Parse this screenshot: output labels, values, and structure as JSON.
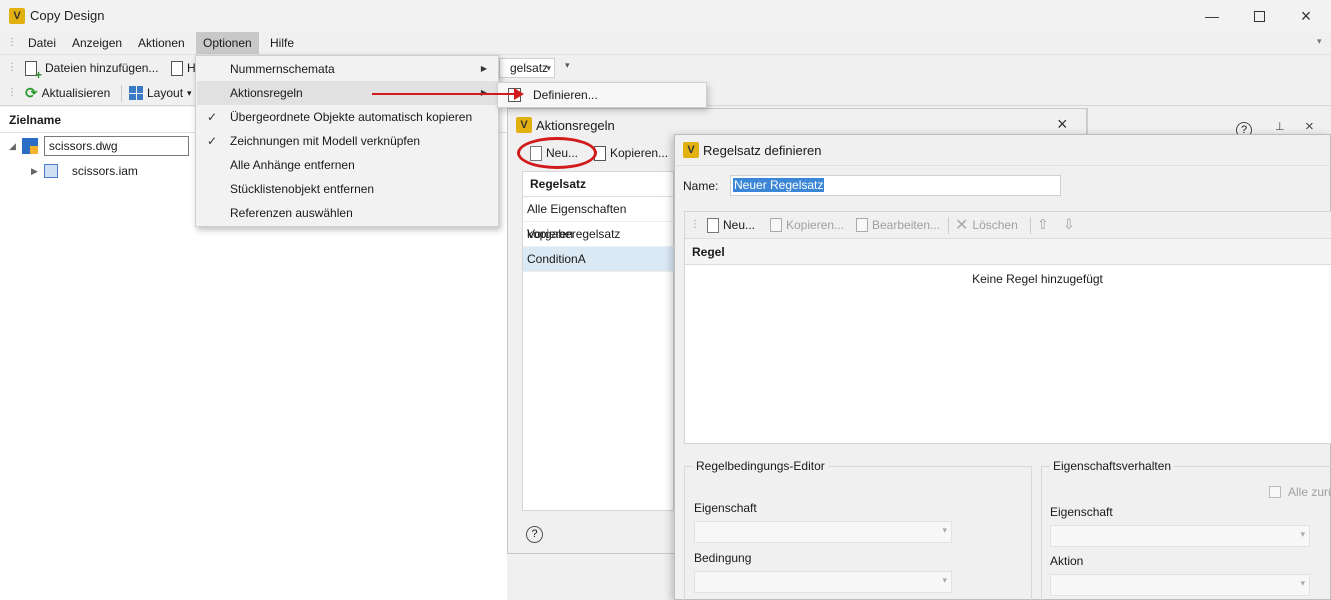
{
  "window": {
    "title": "Copy Design",
    "logo_letter": "V"
  },
  "menubar": {
    "items": [
      "Datei",
      "Anzeigen",
      "Aktionen",
      "Optionen",
      "Hilfe"
    ]
  },
  "toolbar1": {
    "add_files": "Dateien hinzufügen...",
    "partial_label": "H",
    "regelsatz_combo": "gelsatz"
  },
  "toolbar2": {
    "refresh": "Aktualisieren",
    "layout": "Layout"
  },
  "tree": {
    "header": "Zielname",
    "rows": [
      {
        "label": "scissors.dwg"
      },
      {
        "label": "scissors.iam"
      }
    ]
  },
  "context_menu": {
    "items": [
      {
        "label": "Nummernschemata",
        "checked": false,
        "submenu": true
      },
      {
        "label": "Aktionsregeln",
        "checked": false,
        "submenu": true
      },
      {
        "label": "Übergeordnete Objekte automatisch kopieren",
        "checked": true,
        "submenu": false
      },
      {
        "label": "Zeichnungen mit Modell verknüpfen",
        "checked": true,
        "submenu": false
      },
      {
        "label": "Alle Anhänge entfernen",
        "checked": false,
        "submenu": false
      },
      {
        "label": "Stücklistenobjekt entfernen",
        "checked": false,
        "submenu": false
      },
      {
        "label": "Referenzen auswählen",
        "checked": false,
        "submenu": false
      }
    ],
    "submenu_label": "Definieren..."
  },
  "aktionsregeln": {
    "title": "Aktionsregeln",
    "new_button": "Neu...",
    "copy_button": "Kopieren...",
    "list_header": "Regelsatz",
    "list_items": [
      "Alle Eigenschaften kopieren",
      "Vorgaberegelsatz",
      "ConditionA"
    ],
    "selected_index": 2
  },
  "regelsatz_dialog": {
    "title": "Regelsatz definieren",
    "name_label": "Name:",
    "name_value": "Neuer Regelsatz",
    "toolbar": {
      "new": "Neu...",
      "copy": "Kopieren...",
      "edit": "Bearbeiten...",
      "delete": "Löschen"
    },
    "grid_header": "Regel",
    "empty_text": "Keine Regel hinzugefügt",
    "condition_editor": {
      "title": "Regelbedingungs-Editor",
      "property_label": "Eigenschaft",
      "condition_label": "Bedingung"
    },
    "property_behavior": {
      "title": "Eigenschaftsverhalten",
      "all_reset_label": "Alle zurü",
      "property_label": "Eigenschaft",
      "action_label": "Aktion"
    }
  },
  "colors": {
    "annotation_red": "#d11b1b",
    "selection_blue": "#3b86d6",
    "list_selected_bg": "#dbe9f5",
    "logo_yellow": "#e2b10f"
  }
}
